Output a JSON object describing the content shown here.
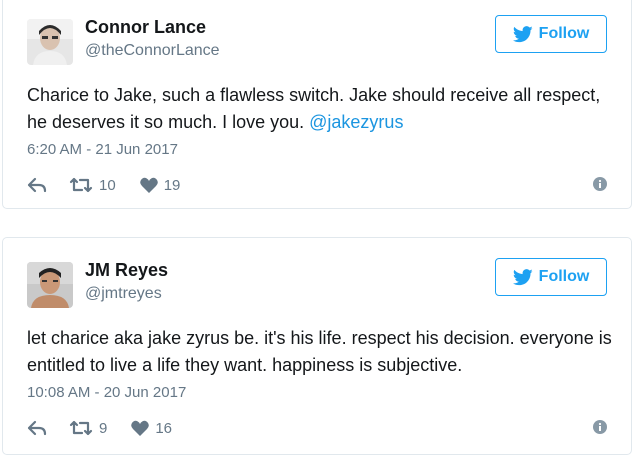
{
  "colors": {
    "accent": "#1da1f2",
    "link": "#1b95e0",
    "muted": "#657786",
    "border": "#e1e8ed"
  },
  "tweets": [
    {
      "name": "Connor Lance",
      "handle": "@theConnorLance",
      "follow_label": "Follow",
      "text": "Charice to Jake, such a flawless switch. Jake should receive all respect, he deserves it so much. I love you. ",
      "mention": "@jakezyrus",
      "timestamp": "6:20 AM - 21 Jun 2017",
      "retweets": "10",
      "likes": "19",
      "icons": [
        "reply-icon",
        "retweet-icon",
        "heart-icon",
        "info-icon",
        "twitter-bird-icon"
      ]
    },
    {
      "name": "JM Reyes",
      "handle": "@jmtreyes",
      "follow_label": "Follow",
      "text": "let charice aka jake zyrus be. it's his life. respect his decision. everyone is entitled to live a life they want. happiness is subjective.",
      "timestamp": "10:08 AM - 20 Jun 2017",
      "retweets": "9",
      "likes": "16",
      "icons": [
        "reply-icon",
        "retweet-icon",
        "heart-icon",
        "info-icon",
        "twitter-bird-icon"
      ]
    }
  ]
}
